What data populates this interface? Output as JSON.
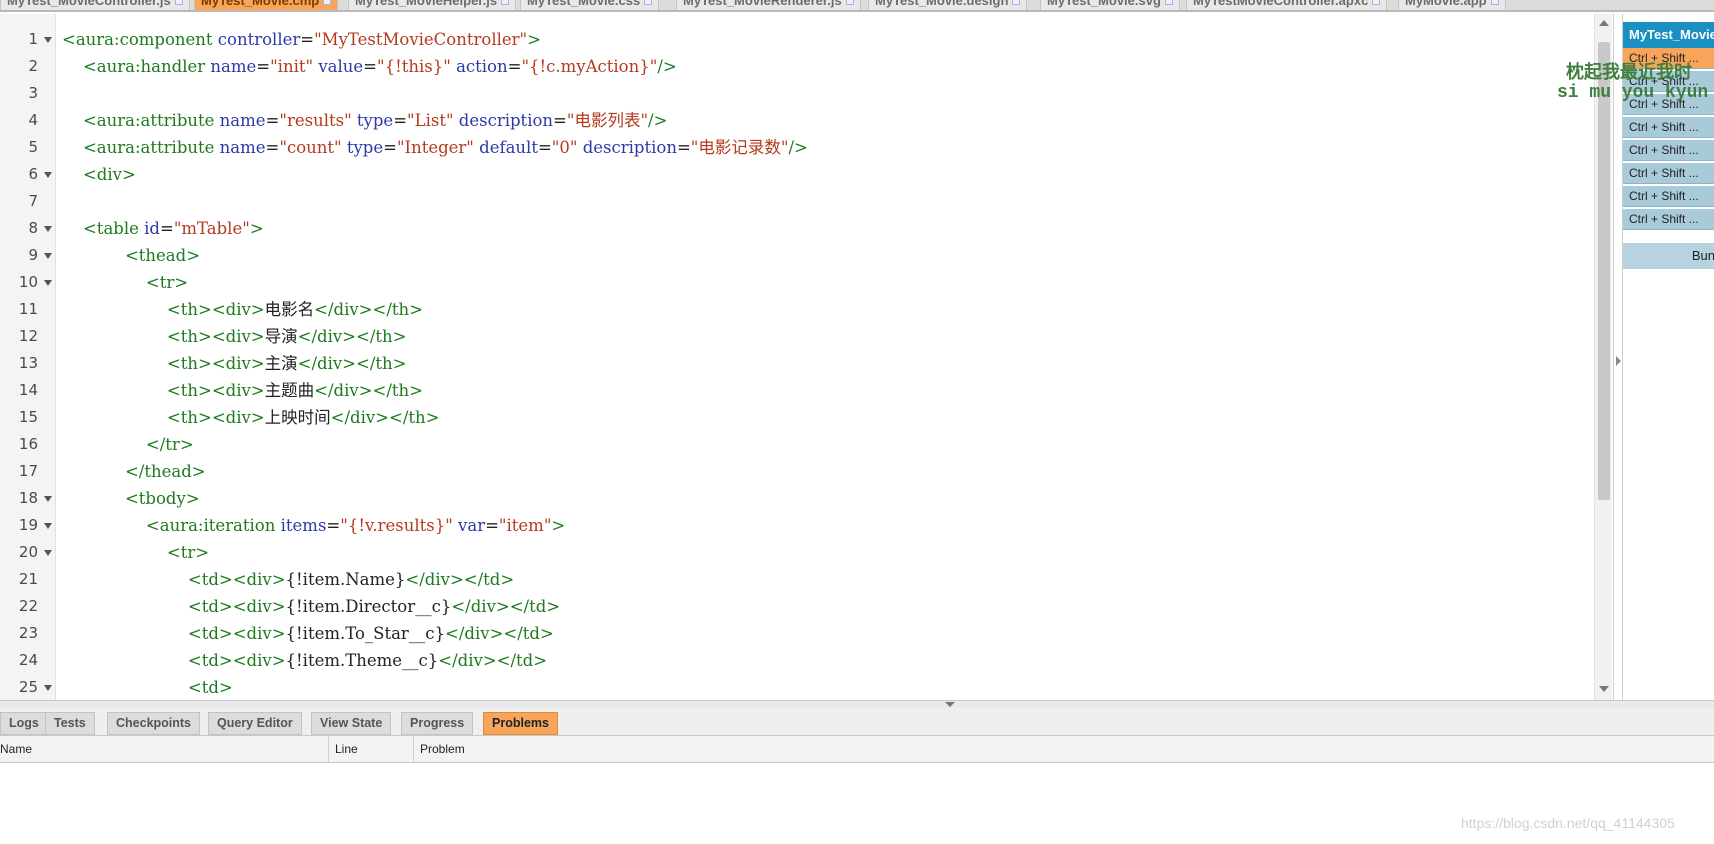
{
  "file_tabs": [
    {
      "label": "MyTest_MovieController.js",
      "active": false
    },
    {
      "label": "MyTest_Movie.cmp",
      "active": true
    },
    {
      "label": "MyTest_MovieHelper.js",
      "active": false
    },
    {
      "label": "MyTest_Movie.css",
      "active": false
    },
    {
      "label": "MyTest_MovieRenderer.js",
      "active": false
    },
    {
      "label": "MyTest_Movie.design",
      "active": false
    },
    {
      "label": "MyTest_Movie.svg",
      "active": false
    },
    {
      "label": "MyTestMovieController.apxc",
      "active": false
    },
    {
      "label": "MyMovie.app",
      "active": false
    }
  ],
  "editor": {
    "lines": [
      {
        "n": "1",
        "fold": true,
        "tokens": [
          [
            "tag",
            "<aura:component"
          ],
          [
            "txt",
            " "
          ],
          [
            "attr",
            "controller"
          ],
          [
            "txt",
            "="
          ],
          [
            "str",
            "\"MyTestMovieController\""
          ],
          [
            "tag",
            ">"
          ]
        ]
      },
      {
        "n": "2",
        "fold": false,
        "tokens": [
          [
            "txt",
            "    "
          ],
          [
            "tag",
            "<aura:handler"
          ],
          [
            "txt",
            " "
          ],
          [
            "attr",
            "name"
          ],
          [
            "txt",
            "="
          ],
          [
            "str",
            "\"init\""
          ],
          [
            "txt",
            " "
          ],
          [
            "attr",
            "value"
          ],
          [
            "txt",
            "="
          ],
          [
            "str",
            "\"{!this}\""
          ],
          [
            "txt",
            " "
          ],
          [
            "attr",
            "action"
          ],
          [
            "txt",
            "="
          ],
          [
            "str",
            "\"{!c.myAction}\""
          ],
          [
            "tag",
            "/>"
          ]
        ]
      },
      {
        "n": "3",
        "fold": false,
        "tokens": []
      },
      {
        "n": "4",
        "fold": false,
        "tokens": [
          [
            "txt",
            "    "
          ],
          [
            "tag",
            "<aura:attribute"
          ],
          [
            "txt",
            " "
          ],
          [
            "attr",
            "name"
          ],
          [
            "txt",
            "="
          ],
          [
            "str",
            "\"results\""
          ],
          [
            "txt",
            " "
          ],
          [
            "attr",
            "type"
          ],
          [
            "txt",
            "="
          ],
          [
            "str",
            "\"List\""
          ],
          [
            "txt",
            " "
          ],
          [
            "attr",
            "description"
          ],
          [
            "txt",
            "="
          ],
          [
            "str",
            "\"电影列表\""
          ],
          [
            "tag",
            "/>"
          ]
        ]
      },
      {
        "n": "5",
        "fold": false,
        "tokens": [
          [
            "txt",
            "    "
          ],
          [
            "tag",
            "<aura:attribute"
          ],
          [
            "txt",
            " "
          ],
          [
            "attr",
            "name"
          ],
          [
            "txt",
            "="
          ],
          [
            "str",
            "\"count\""
          ],
          [
            "txt",
            " "
          ],
          [
            "attr",
            "type"
          ],
          [
            "txt",
            "="
          ],
          [
            "str",
            "\"Integer\""
          ],
          [
            "txt",
            " "
          ],
          [
            "attr",
            "default"
          ],
          [
            "txt",
            "="
          ],
          [
            "str",
            "\"0\""
          ],
          [
            "txt",
            " "
          ],
          [
            "attr",
            "description"
          ],
          [
            "txt",
            "="
          ],
          [
            "str",
            "\"电影记录数\""
          ],
          [
            "tag",
            "/>"
          ]
        ]
      },
      {
        "n": "6",
        "fold": true,
        "tokens": [
          [
            "txt",
            "    "
          ],
          [
            "tag",
            "<div>"
          ]
        ]
      },
      {
        "n": "7",
        "fold": false,
        "tokens": []
      },
      {
        "n": "8",
        "fold": true,
        "tokens": [
          [
            "txt",
            "    "
          ],
          [
            "tag",
            "<table"
          ],
          [
            "txt",
            " "
          ],
          [
            "attr",
            "id"
          ],
          [
            "txt",
            "="
          ],
          [
            "str",
            "\"mTable\""
          ],
          [
            "tag",
            ">"
          ]
        ]
      },
      {
        "n": "9",
        "fold": true,
        "tokens": [
          [
            "txt",
            "            "
          ],
          [
            "tag",
            "<thead>"
          ]
        ]
      },
      {
        "n": "10",
        "fold": true,
        "tokens": [
          [
            "txt",
            "                "
          ],
          [
            "tag",
            "<tr>"
          ]
        ]
      },
      {
        "n": "11",
        "fold": false,
        "tokens": [
          [
            "txt",
            "                    "
          ],
          [
            "tag",
            "<th><div>"
          ],
          [
            "txt",
            "电影名"
          ],
          [
            "tag",
            "</div></th>"
          ]
        ]
      },
      {
        "n": "12",
        "fold": false,
        "tokens": [
          [
            "txt",
            "                    "
          ],
          [
            "tag",
            "<th><div>"
          ],
          [
            "txt",
            "导演"
          ],
          [
            "tag",
            "</div></th>"
          ]
        ]
      },
      {
        "n": "13",
        "fold": false,
        "tokens": [
          [
            "txt",
            "                    "
          ],
          [
            "tag",
            "<th><div>"
          ],
          [
            "txt",
            "主演"
          ],
          [
            "tag",
            "</div></th>"
          ]
        ]
      },
      {
        "n": "14",
        "fold": false,
        "tokens": [
          [
            "txt",
            "                    "
          ],
          [
            "tag",
            "<th><div>"
          ],
          [
            "txt",
            "主题曲"
          ],
          [
            "tag",
            "</div></th>"
          ]
        ]
      },
      {
        "n": "15",
        "fold": false,
        "tokens": [
          [
            "txt",
            "                    "
          ],
          [
            "tag",
            "<th><div>"
          ],
          [
            "txt",
            "上映时间"
          ],
          [
            "tag",
            "</div></th>"
          ]
        ]
      },
      {
        "n": "16",
        "fold": false,
        "tokens": [
          [
            "txt",
            "                "
          ],
          [
            "tag",
            "</tr>"
          ]
        ]
      },
      {
        "n": "17",
        "fold": false,
        "tokens": [
          [
            "txt",
            "            "
          ],
          [
            "tag",
            "</thead>"
          ]
        ]
      },
      {
        "n": "18",
        "fold": true,
        "tokens": [
          [
            "txt",
            "            "
          ],
          [
            "tag",
            "<tbody>"
          ]
        ]
      },
      {
        "n": "19",
        "fold": true,
        "tokens": [
          [
            "txt",
            "                "
          ],
          [
            "tag",
            "<aura:iteration"
          ],
          [
            "txt",
            " "
          ],
          [
            "attr",
            "items"
          ],
          [
            "txt",
            "="
          ],
          [
            "str",
            "\"{!v.results}\""
          ],
          [
            "txt",
            " "
          ],
          [
            "attr",
            "var"
          ],
          [
            "txt",
            "="
          ],
          [
            "str",
            "\"item\""
          ],
          [
            "tag",
            ">"
          ]
        ]
      },
      {
        "n": "20",
        "fold": true,
        "tokens": [
          [
            "txt",
            "                    "
          ],
          [
            "tag",
            "<tr>"
          ]
        ]
      },
      {
        "n": "21",
        "fold": false,
        "tokens": [
          [
            "txt",
            "                        "
          ],
          [
            "tag",
            "<td><div>"
          ],
          [
            "txt",
            "{!item.Name}"
          ],
          [
            "tag",
            "</div></td>"
          ]
        ]
      },
      {
        "n": "22",
        "fold": false,
        "tokens": [
          [
            "txt",
            "                        "
          ],
          [
            "tag",
            "<td><div>"
          ],
          [
            "txt",
            "{!item.Director__c}"
          ],
          [
            "tag",
            "</div></td>"
          ]
        ]
      },
      {
        "n": "23",
        "fold": false,
        "tokens": [
          [
            "txt",
            "                        "
          ],
          [
            "tag",
            "<td><div>"
          ],
          [
            "txt",
            "{!item.To_Star__c}"
          ],
          [
            "tag",
            "</div></td>"
          ]
        ]
      },
      {
        "n": "24",
        "fold": false,
        "tokens": [
          [
            "txt",
            "                        "
          ],
          [
            "tag",
            "<td><div>"
          ],
          [
            "txt",
            "{!item.Theme__c}"
          ],
          [
            "tag",
            "</div></td>"
          ]
        ]
      },
      {
        "n": "25",
        "fold": true,
        "tokens": [
          [
            "txt",
            "                        "
          ],
          [
            "tag",
            "<td>"
          ]
        ]
      }
    ]
  },
  "side_panel": {
    "title": "MyTest_Movie",
    "shortcuts": [
      "Ctrl + Shift ...",
      "Ctrl + Shift ...",
      "Ctrl + Shift ...",
      "Ctrl + Shift ...",
      "Ctrl + Shift ...",
      "Ctrl + Shift ...",
      "Ctrl + Shift ...",
      "Ctrl + Shift ..."
    ],
    "button": "Bun",
    "overlay_cjk": "枕起我最近我时",
    "overlay_roman": "si mu you kyun"
  },
  "bottom_tabs": [
    {
      "label": "Logs",
      "active": false
    },
    {
      "label": "Tests",
      "active": false
    },
    {
      "label": "Checkpoints",
      "active": false
    },
    {
      "label": "Query Editor",
      "active": false
    },
    {
      "label": "View State",
      "active": false
    },
    {
      "label": "Progress",
      "active": false
    },
    {
      "label": "Problems",
      "active": true
    }
  ],
  "problems": {
    "columns": [
      "Name",
      "Line",
      "Problem"
    ]
  },
  "watermark": "https://blog.csdn.net/qq_41144305",
  "colors": {
    "tag": "#1d7a1d",
    "attr": "#2b3aa8",
    "string": "#b43a1e",
    "active_tab": "#f7a55a",
    "panel_title": "#1a8fc2"
  }
}
